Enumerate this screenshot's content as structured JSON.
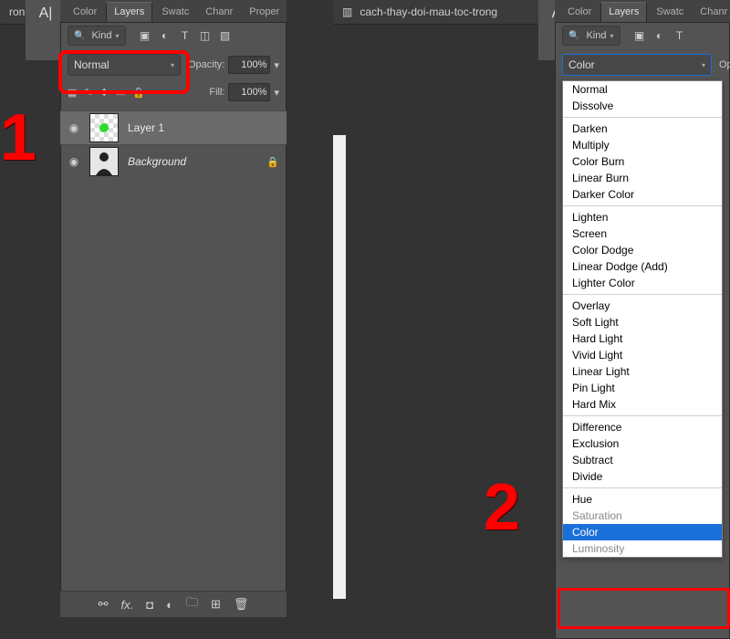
{
  "tabs": {
    "t0": "Color",
    "t1": "Layers",
    "t2": "Swatc",
    "t3": "Chanr",
    "t4": "Proper"
  },
  "kind_label": "Kind",
  "blend_left": "Normal",
  "blend_right": "Color",
  "opacity_label": "Opacity:",
  "opacity_value": "100%",
  "fill_label": "Fill:",
  "fill_value": "100%",
  "layers": [
    {
      "name": "Layer 1",
      "italic": false,
      "locked": false
    },
    {
      "name": "Background",
      "italic": true,
      "locked": true
    }
  ],
  "doc_tab_left": "rong",
  "doc_tab_right": "cach-thay-doi-mau-toc-trong",
  "step1": "1",
  "step2": "2",
  "blend_modes": {
    "g0": [
      "Normal",
      "Dissolve"
    ],
    "g1": [
      "Darken",
      "Multiply",
      "Color Burn",
      "Linear Burn",
      "Darker Color"
    ],
    "g2": [
      "Lighten",
      "Screen",
      "Color Dodge",
      "Linear Dodge (Add)",
      "Lighter Color"
    ],
    "g3": [
      "Overlay",
      "Soft Light",
      "Hard Light",
      "Vivid Light",
      "Linear Light",
      "Pin Light",
      "Hard Mix"
    ],
    "g4": [
      "Difference",
      "Exclusion",
      "Subtract",
      "Divide"
    ],
    "g5": [
      "Hue",
      "Saturation",
      "Color",
      "Luminosity"
    ]
  },
  "selected_mode": "Color",
  "opac_label_short": "Opac"
}
